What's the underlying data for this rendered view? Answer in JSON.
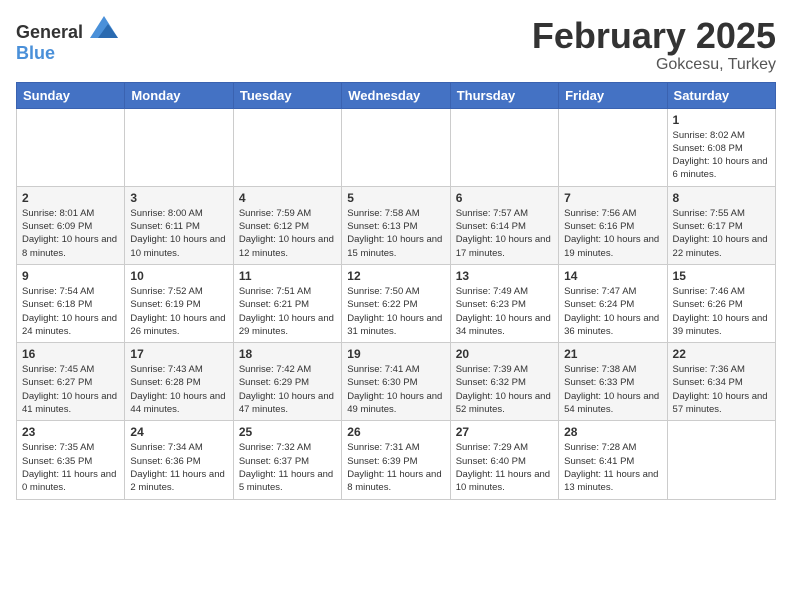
{
  "header": {
    "logo_general": "General",
    "logo_blue": "Blue",
    "month": "February 2025",
    "location": "Gokcesu, Turkey"
  },
  "weekdays": [
    "Sunday",
    "Monday",
    "Tuesday",
    "Wednesday",
    "Thursday",
    "Friday",
    "Saturday"
  ],
  "weeks": [
    [
      null,
      null,
      null,
      null,
      null,
      null,
      {
        "day": "1",
        "sunrise": "8:02 AM",
        "sunset": "6:08 PM",
        "daylight": "10 hours and 6 minutes."
      }
    ],
    [
      {
        "day": "2",
        "sunrise": "8:01 AM",
        "sunset": "6:09 PM",
        "daylight": "10 hours and 8 minutes."
      },
      {
        "day": "3",
        "sunrise": "8:00 AM",
        "sunset": "6:11 PM",
        "daylight": "10 hours and 10 minutes."
      },
      {
        "day": "4",
        "sunrise": "7:59 AM",
        "sunset": "6:12 PM",
        "daylight": "10 hours and 12 minutes."
      },
      {
        "day": "5",
        "sunrise": "7:58 AM",
        "sunset": "6:13 PM",
        "daylight": "10 hours and 15 minutes."
      },
      {
        "day": "6",
        "sunrise": "7:57 AM",
        "sunset": "6:14 PM",
        "daylight": "10 hours and 17 minutes."
      },
      {
        "day": "7",
        "sunrise": "7:56 AM",
        "sunset": "6:16 PM",
        "daylight": "10 hours and 19 minutes."
      },
      {
        "day": "8",
        "sunrise": "7:55 AM",
        "sunset": "6:17 PM",
        "daylight": "10 hours and 22 minutes."
      }
    ],
    [
      {
        "day": "9",
        "sunrise": "7:54 AM",
        "sunset": "6:18 PM",
        "daylight": "10 hours and 24 minutes."
      },
      {
        "day": "10",
        "sunrise": "7:52 AM",
        "sunset": "6:19 PM",
        "daylight": "10 hours and 26 minutes."
      },
      {
        "day": "11",
        "sunrise": "7:51 AM",
        "sunset": "6:21 PM",
        "daylight": "10 hours and 29 minutes."
      },
      {
        "day": "12",
        "sunrise": "7:50 AM",
        "sunset": "6:22 PM",
        "daylight": "10 hours and 31 minutes."
      },
      {
        "day": "13",
        "sunrise": "7:49 AM",
        "sunset": "6:23 PM",
        "daylight": "10 hours and 34 minutes."
      },
      {
        "day": "14",
        "sunrise": "7:47 AM",
        "sunset": "6:24 PM",
        "daylight": "10 hours and 36 minutes."
      },
      {
        "day": "15",
        "sunrise": "7:46 AM",
        "sunset": "6:26 PM",
        "daylight": "10 hours and 39 minutes."
      }
    ],
    [
      {
        "day": "16",
        "sunrise": "7:45 AM",
        "sunset": "6:27 PM",
        "daylight": "10 hours and 41 minutes."
      },
      {
        "day": "17",
        "sunrise": "7:43 AM",
        "sunset": "6:28 PM",
        "daylight": "10 hours and 44 minutes."
      },
      {
        "day": "18",
        "sunrise": "7:42 AM",
        "sunset": "6:29 PM",
        "daylight": "10 hours and 47 minutes."
      },
      {
        "day": "19",
        "sunrise": "7:41 AM",
        "sunset": "6:30 PM",
        "daylight": "10 hours and 49 minutes."
      },
      {
        "day": "20",
        "sunrise": "7:39 AM",
        "sunset": "6:32 PM",
        "daylight": "10 hours and 52 minutes."
      },
      {
        "day": "21",
        "sunrise": "7:38 AM",
        "sunset": "6:33 PM",
        "daylight": "10 hours and 54 minutes."
      },
      {
        "day": "22",
        "sunrise": "7:36 AM",
        "sunset": "6:34 PM",
        "daylight": "10 hours and 57 minutes."
      }
    ],
    [
      {
        "day": "23",
        "sunrise": "7:35 AM",
        "sunset": "6:35 PM",
        "daylight": "11 hours and 0 minutes."
      },
      {
        "day": "24",
        "sunrise": "7:34 AM",
        "sunset": "6:36 PM",
        "daylight": "11 hours and 2 minutes."
      },
      {
        "day": "25",
        "sunrise": "7:32 AM",
        "sunset": "6:37 PM",
        "daylight": "11 hours and 5 minutes."
      },
      {
        "day": "26",
        "sunrise": "7:31 AM",
        "sunset": "6:39 PM",
        "daylight": "11 hours and 8 minutes."
      },
      {
        "day": "27",
        "sunrise": "7:29 AM",
        "sunset": "6:40 PM",
        "daylight": "11 hours and 10 minutes."
      },
      {
        "day": "28",
        "sunrise": "7:28 AM",
        "sunset": "6:41 PM",
        "daylight": "11 hours and 13 minutes."
      },
      null
    ]
  ]
}
